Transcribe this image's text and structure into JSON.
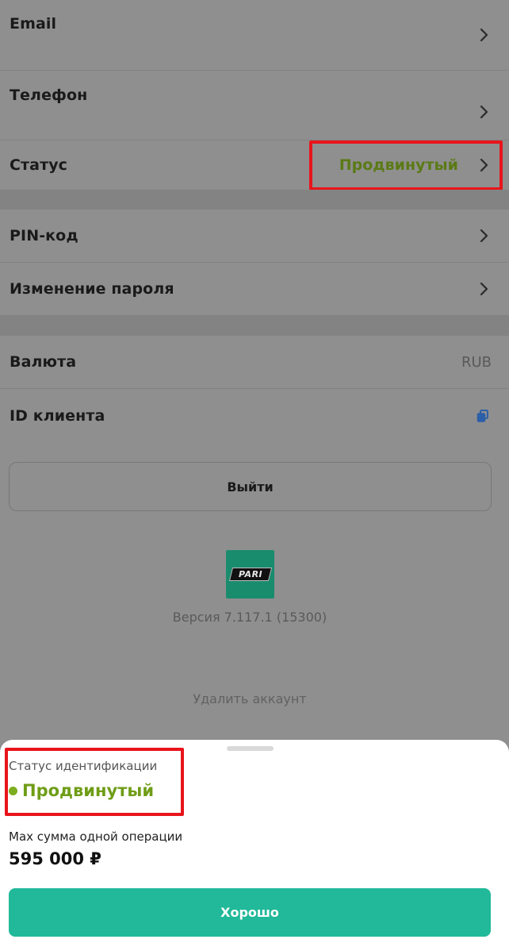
{
  "settings": {
    "email_label": "Email",
    "phone_label": "Телефон",
    "status_label": "Статус",
    "status_value": "Продвинутый",
    "pin_label": "PIN-код",
    "password_label": "Изменение пароля",
    "currency_label": "Валюта",
    "currency_value": "RUB",
    "client_id_label": "ID клиента"
  },
  "logout_label": "Выйти",
  "logo_text": "PARI",
  "version_text": "Версия 7.117.1 (15300)",
  "delete_account_label": "Удалить аккаунт",
  "sheet": {
    "subtitle": "Статус идентификации",
    "status": "Продвинутый",
    "max_label": "Max сумма одной операции",
    "max_value": "595 000 ₽",
    "ok_label": "Хорошо"
  },
  "colors": {
    "accent_green": "#21b999",
    "status_green": "#6f9d16",
    "highlight_red": "#e8141b"
  }
}
